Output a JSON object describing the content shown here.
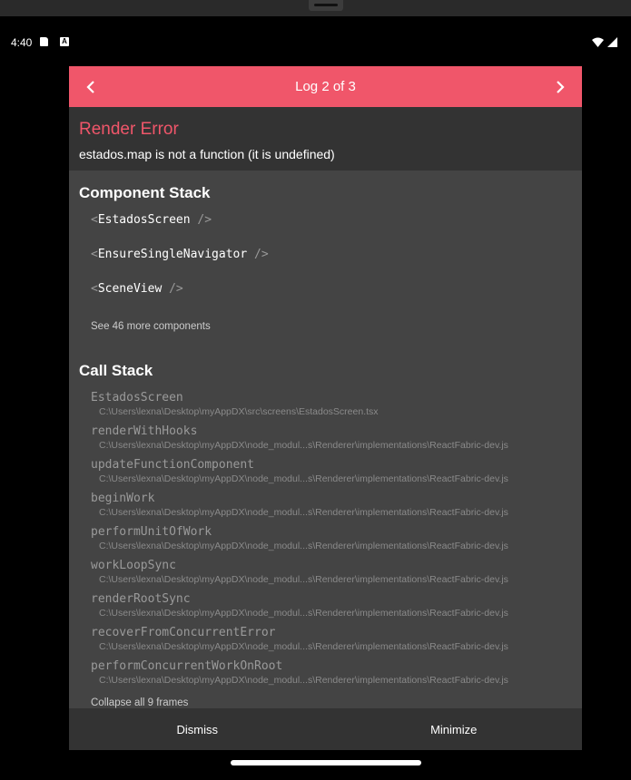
{
  "status_bar": {
    "time": "4:40",
    "icons": [
      "sd-card-icon",
      "a-notification-icon",
      "wifi-icon",
      "signal-icon"
    ]
  },
  "header": {
    "title": "Log 2 of 3",
    "prev_icon": "chevron-left-icon",
    "next_icon": "chevron-right-icon"
  },
  "error": {
    "title": "Render Error",
    "message": "estados.map is not a function (it is undefined)"
  },
  "component_stack": {
    "title": "Component Stack",
    "items": [
      {
        "open": "<",
        "name": "EstadosScreen",
        "close": " />"
      },
      {
        "open": "<",
        "name": "EnsureSingleNavigator",
        "close": " />"
      },
      {
        "open": "<",
        "name": "SceneView",
        "close": " />"
      }
    ],
    "more": "See 46 more components"
  },
  "call_stack": {
    "title": "Call Stack",
    "frames": [
      {
        "fn": "EstadosScreen",
        "file": "C:\\Users\\lexna\\Desktop\\myAppDX\\src\\screens\\EstadosScreen.tsx"
      },
      {
        "fn": "renderWithHooks",
        "file": "C:\\Users\\lexna\\Desktop\\myAppDX\\node_modul...s\\Renderer\\implementations\\ReactFabric-dev.js"
      },
      {
        "fn": "updateFunctionComponent",
        "file": "C:\\Users\\lexna\\Desktop\\myAppDX\\node_modul...s\\Renderer\\implementations\\ReactFabric-dev.js"
      },
      {
        "fn": "beginWork",
        "file": "C:\\Users\\lexna\\Desktop\\myAppDX\\node_modul...s\\Renderer\\implementations\\ReactFabric-dev.js"
      },
      {
        "fn": "performUnitOfWork",
        "file": "C:\\Users\\lexna\\Desktop\\myAppDX\\node_modul...s\\Renderer\\implementations\\ReactFabric-dev.js"
      },
      {
        "fn": "workLoopSync",
        "file": "C:\\Users\\lexna\\Desktop\\myAppDX\\node_modul...s\\Renderer\\implementations\\ReactFabric-dev.js"
      },
      {
        "fn": "renderRootSync",
        "file": "C:\\Users\\lexna\\Desktop\\myAppDX\\node_modul...s\\Renderer\\implementations\\ReactFabric-dev.js"
      },
      {
        "fn": "recoverFromConcurrentError",
        "file": "C:\\Users\\lexna\\Desktop\\myAppDX\\node_modul...s\\Renderer\\implementations\\ReactFabric-dev.js"
      },
      {
        "fn": "performConcurrentWorkOnRoot",
        "file": "C:\\Users\\lexna\\Desktop\\myAppDX\\node_modul...s\\Renderer\\implementations\\ReactFabric-dev.js"
      }
    ],
    "collapse": "Collapse all 9 frames"
  },
  "footer": {
    "dismiss": "Dismiss",
    "minimize": "Minimize"
  },
  "colors": {
    "accent": "#f0566a",
    "panel_bg": "#333333",
    "content_bg": "#444444"
  }
}
